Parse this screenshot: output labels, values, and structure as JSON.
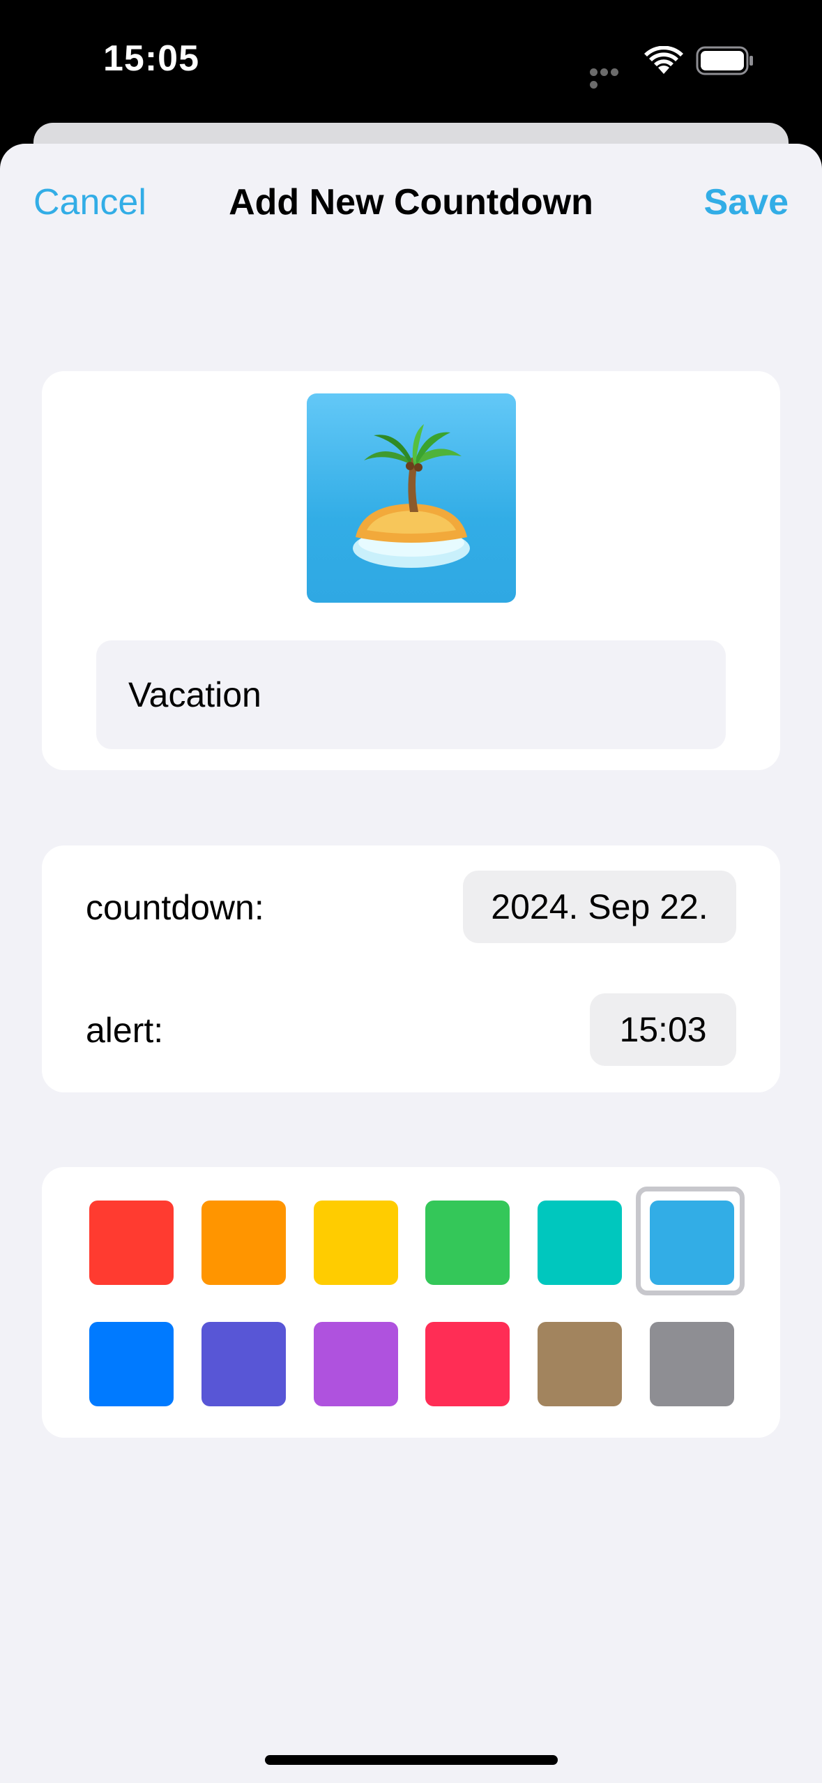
{
  "status_bar": {
    "time": "15:05"
  },
  "nav": {
    "cancel_label": "Cancel",
    "title": "Add New Countdown",
    "save_label": "Save",
    "accent_color": "#32ade6"
  },
  "event": {
    "icon": "desert-island-icon",
    "icon_background": "#32ade6",
    "name_value": "Vacation"
  },
  "fields": {
    "countdown_label": "countdown:",
    "countdown_value": "2024. Sep 22.",
    "alert_label": "alert:",
    "alert_value": "15:03"
  },
  "colors": {
    "selected": "#32ade6",
    "swatches": [
      "#ff3b30",
      "#ff9500",
      "#ffcc00",
      "#34c759",
      "#00c7be",
      "#32ade6",
      "#007aff",
      "#5856d6",
      "#af52de",
      "#ff2d55",
      "#a2845e",
      "#8e8e93"
    ]
  }
}
